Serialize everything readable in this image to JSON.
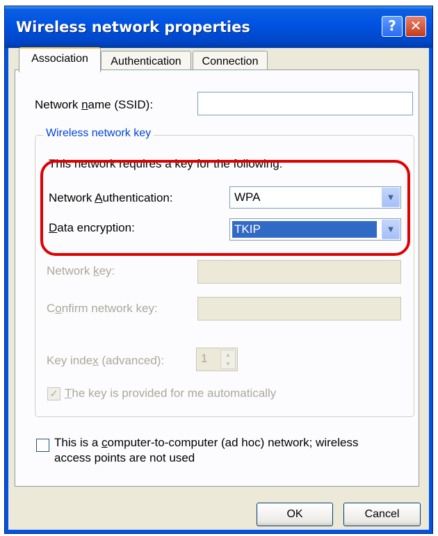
{
  "window": {
    "title": "Wireless network properties"
  },
  "titlebar": {
    "help_label": "?",
    "close_label": "✕"
  },
  "tabs": [
    {
      "label": "Association"
    },
    {
      "label": "Authentication"
    },
    {
      "label": "Connection"
    }
  ],
  "association": {
    "network_name": {
      "label_pre": "Network ",
      "label_key": "n",
      "label_post": "ame (SSID):",
      "value": ""
    },
    "group_title": "Wireless network key",
    "key_required_text": "This network requires a key for the following:",
    "network_auth": {
      "label_pre": "Network ",
      "label_key": "A",
      "label_post": "uthentication:",
      "value": "WPA"
    },
    "data_encryption": {
      "label_key": "D",
      "label_post": "ata encryption:",
      "value": "TKIP"
    },
    "network_key": {
      "label_pre": "Network ",
      "label_key": "k",
      "label_post": "ey:",
      "value": ""
    },
    "confirm_key": {
      "label_pre": "C",
      "label_key": "o",
      "label_post": "nfirm network key:",
      "value": ""
    },
    "key_index": {
      "label_pre": "Key inde",
      "label_key": "x",
      "label_post": " (advanced):",
      "value": "1"
    },
    "auto_key": {
      "label_pre": "",
      "label_key": "T",
      "label_post": "he key is provided for me automatically",
      "checked": true
    },
    "adhoc": {
      "line1_pre": "This is a ",
      "line1_key": "c",
      "line1_post": "omputer-to-computer (ad hoc) network; wireless",
      "line2": "access points are not used",
      "checked": false
    }
  },
  "buttons": {
    "ok": "OK",
    "cancel": "Cancel"
  },
  "icons": {
    "checkmark": "✓",
    "dropdown_arrow": "▼",
    "spin_up": "▲",
    "spin_down": "▼"
  },
  "colors": {
    "titlebar": "#0054e3",
    "highlight_outline": "#e00000",
    "group_title": "#0046d5",
    "selection": "#316ac5"
  }
}
